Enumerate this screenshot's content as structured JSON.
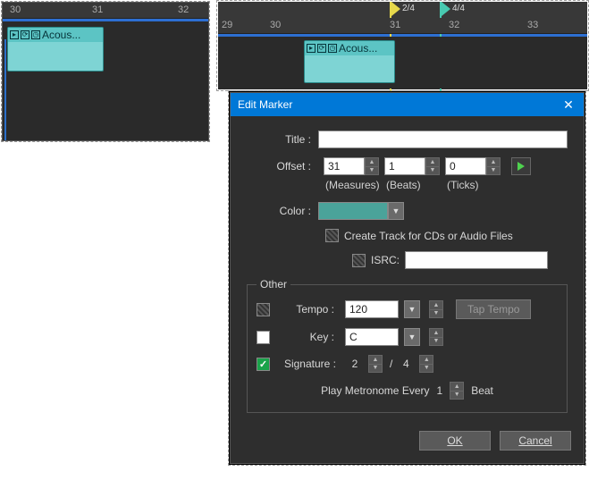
{
  "left_timeline": {
    "rulers": [
      "30",
      "31",
      "32"
    ],
    "clip_label": "Acous..."
  },
  "right_timeline": {
    "rulers": [
      "29",
      "30",
      "31",
      "32",
      "33"
    ],
    "clip_label": "Acous...",
    "markers": [
      {
        "sig": "2/4"
      },
      {
        "sig": "4/4"
      }
    ]
  },
  "dialog": {
    "title": "Edit Marker",
    "labels": {
      "title": "Title :",
      "offset": "Offset :",
      "color": "Color :",
      "isrc": "ISRC:",
      "tempo": "Tempo :",
      "key": "Key :",
      "signature": "Signature :"
    },
    "title_value": "",
    "offset": {
      "measures": "31",
      "beats": "1",
      "ticks": "0"
    },
    "offset_labels": {
      "measures": "(Measures)",
      "beats": "(Beats)",
      "ticks": "(Ticks)"
    },
    "color": "#4aa39a",
    "create_track_label": "Create Track for CDs or Audio Files",
    "isrc_value": "",
    "other_legend": "Other",
    "tempo_value": "120",
    "tap_tempo_label": "Tap Tempo",
    "key_value": "C",
    "signature": {
      "num": "2",
      "den": "4",
      "sep": "/"
    },
    "metronome": {
      "prefix": "Play Metronome Every",
      "value": "1",
      "suffix": "Beat"
    },
    "buttons": {
      "ok": "OK",
      "cancel": "Cancel"
    }
  }
}
